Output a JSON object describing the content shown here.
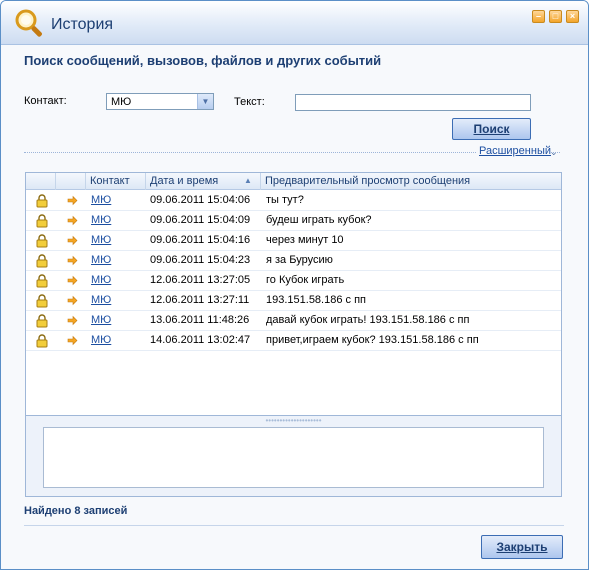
{
  "window": {
    "title": "История",
    "buttons": {
      "minimize": "–",
      "maximize": "□",
      "close": "×"
    }
  },
  "search": {
    "heading": "Поиск сообщений, вызовов, файлов и других событий",
    "contact_label": "Контакт:",
    "contact_value": "МЮ",
    "text_label": "Текст:",
    "text_value": "",
    "search_button": "Поиск",
    "advanced_link": "Расширенный"
  },
  "table": {
    "columns": [
      "",
      "",
      "Контакт",
      "Дата и время",
      "Предварительный просмотр сообщения"
    ],
    "sorted_column": "Дата и время",
    "sort_direction": "ascending",
    "rows": [
      {
        "contact": "МЮ",
        "datetime": "09.06.2011 15:04:06",
        "preview": "ты тут?"
      },
      {
        "contact": "МЮ",
        "datetime": "09.06.2011 15:04:09",
        "preview": "будеш играть кубок?"
      },
      {
        "contact": "МЮ",
        "datetime": "09.06.2011 15:04:16",
        "preview": "через минут 10"
      },
      {
        "contact": "МЮ",
        "datetime": "09.06.2011 15:04:23",
        "preview": "я за Бурусию"
      },
      {
        "contact": "МЮ",
        "datetime": "12.06.2011 13:27:05",
        "preview": "го Кубок играть"
      },
      {
        "contact": "МЮ",
        "datetime": "12.06.2011 13:27:11",
        "preview": "193.151.58.186 с пп"
      },
      {
        "contact": "МЮ",
        "datetime": "13.06.2011 11:48:26",
        "preview": "давай кубок играть! 193.151.58.186  с пп"
      },
      {
        "contact": "МЮ",
        "datetime": "14.06.2011 13:02:47",
        "preview": "привет,играем кубок? 193.151.58.186 с пп"
      }
    ],
    "row_icons": [
      "lock-icon",
      "arrow-right-icon"
    ]
  },
  "preview_text": "",
  "status": {
    "found": "Найдено 8 записей"
  },
  "footer": {
    "close_button": "Закрыть"
  },
  "colors": {
    "accent": "#1d3f73",
    "link": "#1d4fa1",
    "border": "#9fb7d8",
    "title_buttons": "#f3a52a"
  }
}
